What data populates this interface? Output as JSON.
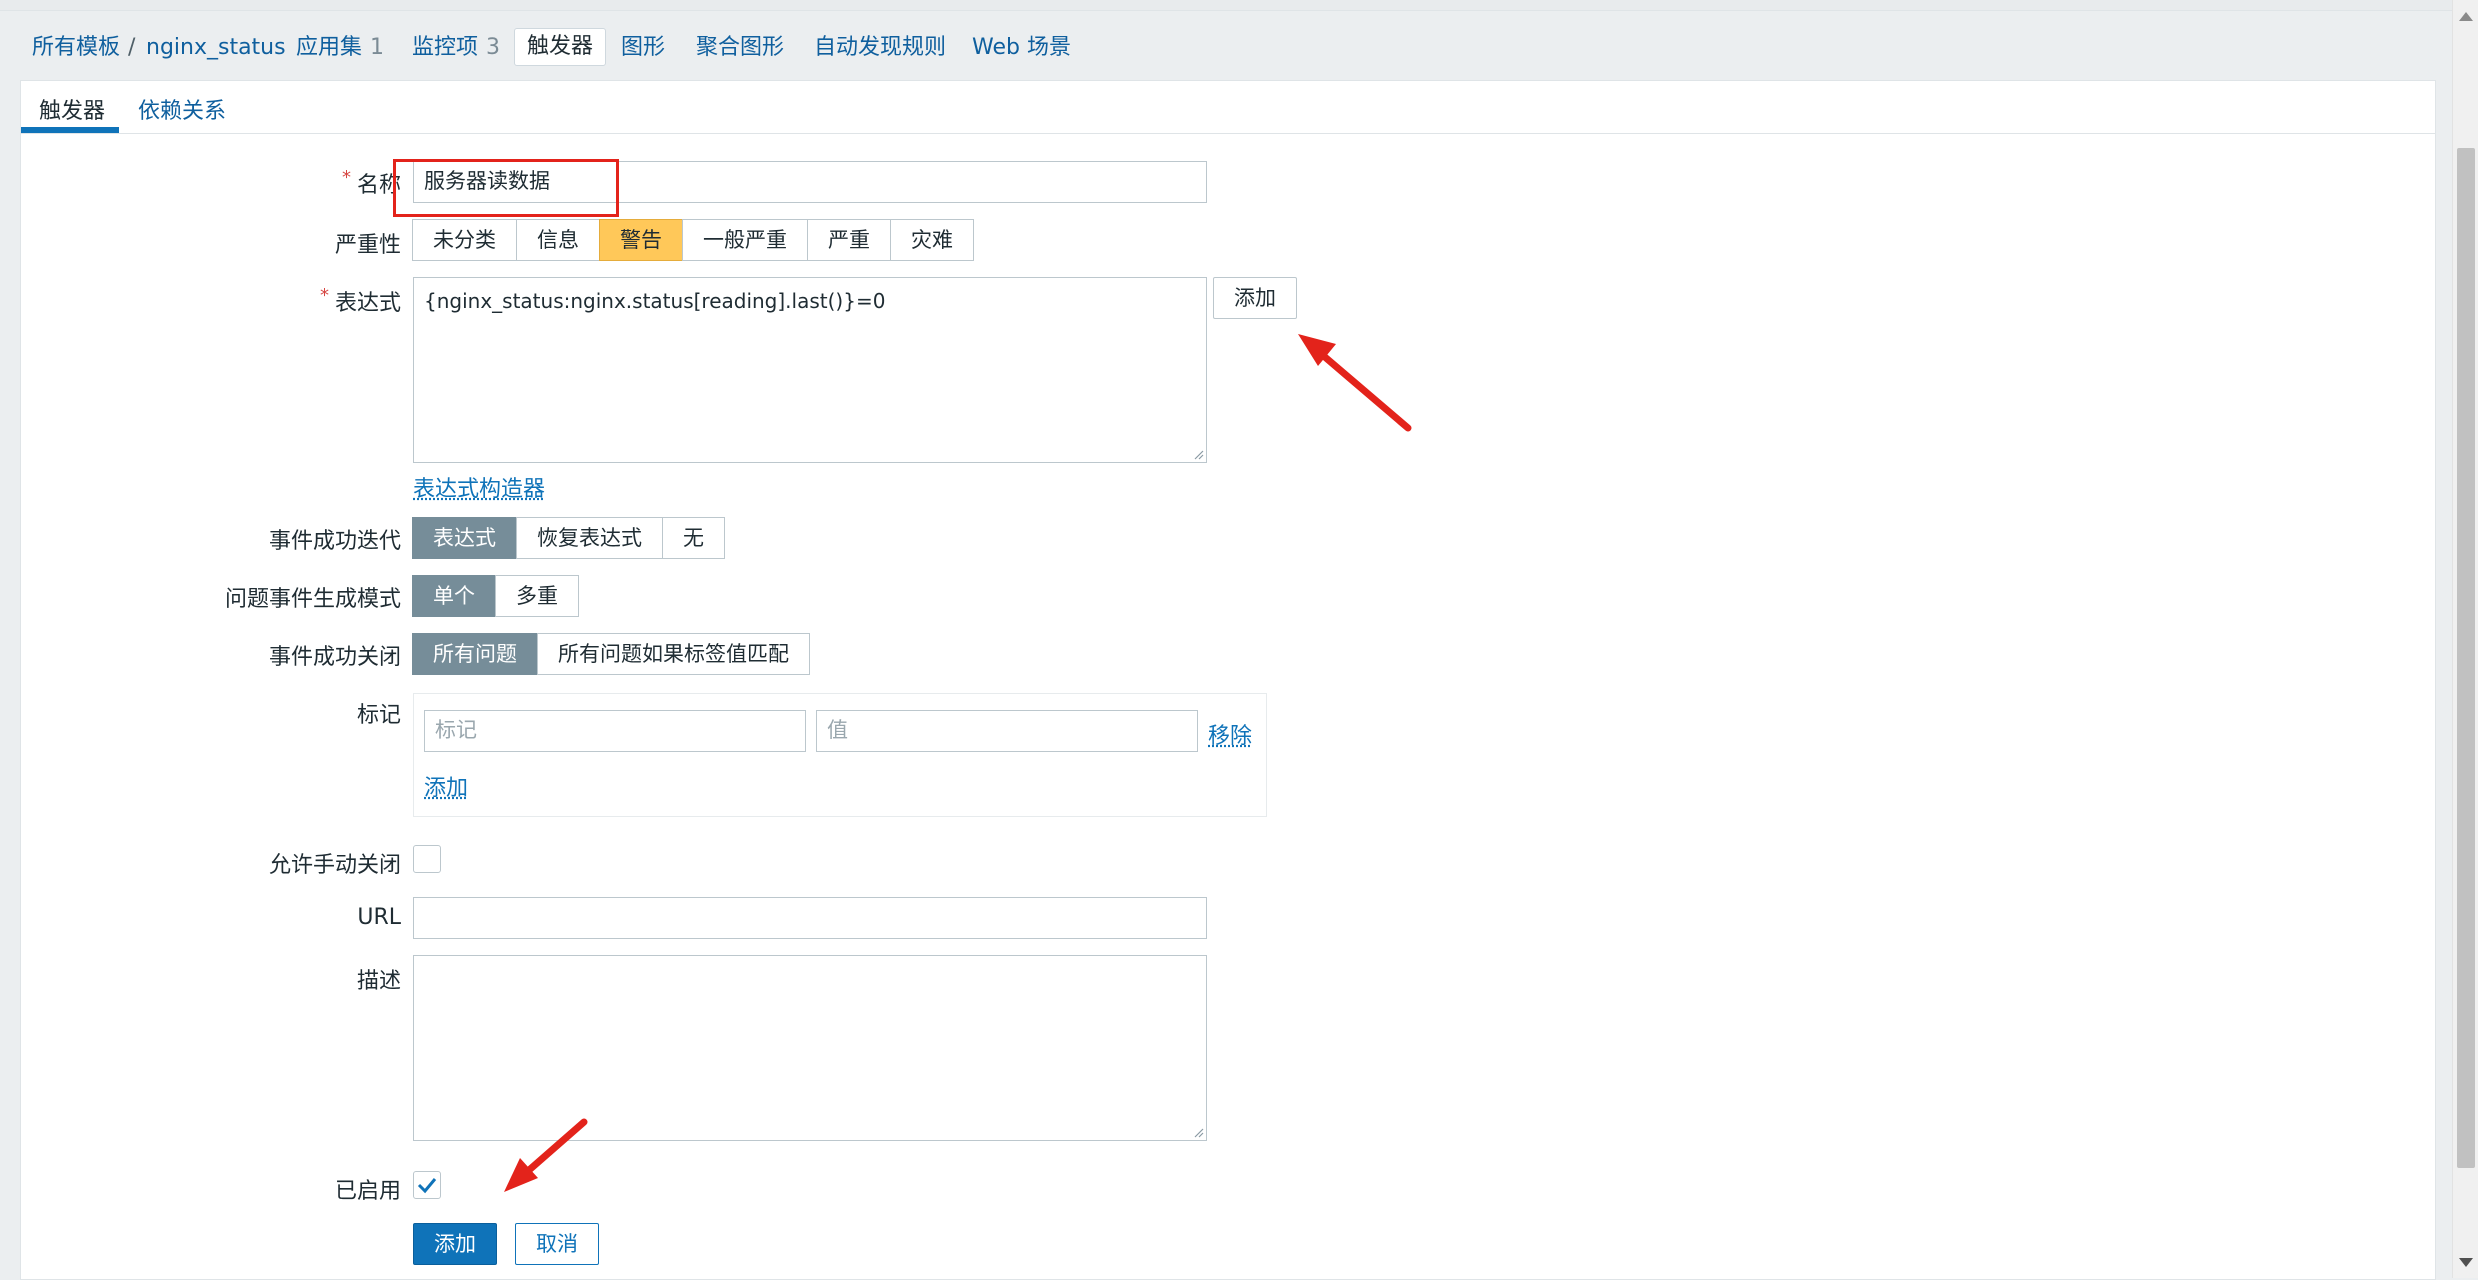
{
  "breadcrumb": {
    "all_templates": "所有模板",
    "separator": "/",
    "template": "nginx_status",
    "applications": "应用集",
    "applications_count": "1",
    "items": "监控项",
    "items_count": "3",
    "triggers": "触发器",
    "graphs": "图形",
    "screens": "聚合图形",
    "discovery": "自动发现规则",
    "web": "Web 场景"
  },
  "tabs": {
    "trigger": "触发器",
    "dependencies": "依赖关系"
  },
  "form": {
    "required_mark": "*",
    "name_label": "名称",
    "name_value": "服务器读数据",
    "severity_label": "严重性",
    "severity_options": [
      "未分类",
      "信息",
      "警告",
      "一般严重",
      "严重",
      "灾难"
    ],
    "severity_selected": "警告",
    "expression_label": "表达式",
    "expression_value": "{nginx_status:nginx.status[reading].last()}=0",
    "expression_add_button": "添加",
    "expression_constructor_link": "表达式构造器",
    "ok_event_label": "事件成功迭代",
    "ok_event_options": [
      "表达式",
      "恢复表达式",
      "无"
    ],
    "problem_mode_label": "问题事件生成模式",
    "problem_mode_options": [
      "单个",
      "多重"
    ],
    "ok_close_label": "事件成功关闭",
    "ok_close_options": [
      "所有问题",
      "所有问题如果标签值匹配"
    ],
    "tags_label": "标记",
    "tag_placeholder": "标记",
    "value_placeholder": "值",
    "tag_remove_link": "移除",
    "tag_add_link": "添加",
    "manual_close_label": "允许手动关闭",
    "manual_close_checked": false,
    "url_label": "URL",
    "url_value": "",
    "description_label": "描述",
    "description_value": "",
    "enabled_label": "已启用",
    "enabled_checked": true,
    "submit_button": "添加",
    "cancel_button": "取消"
  },
  "colors": {
    "accent": "#0f73b9",
    "warning": "#ffc859",
    "selected_segment": "#768d99",
    "annotation_red": "#e3231b"
  }
}
